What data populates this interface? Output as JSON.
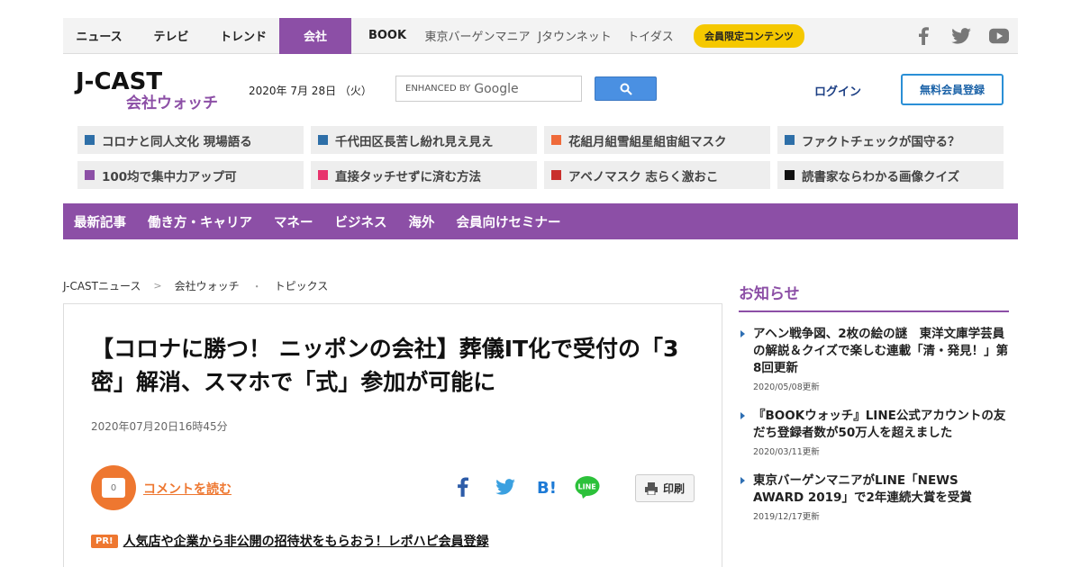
{
  "topnav": {
    "items": [
      "ニュース",
      "テレビ",
      "トレンド",
      "会社",
      "BOOK",
      "東京バーゲンマニア",
      "Jタウンネット",
      "トイダス"
    ],
    "badge": "会員限定コンテンツ",
    "social_icons": [
      "facebook-icon",
      "twitter-icon",
      "youtube-icon"
    ],
    "accent_color": "#8c4fa6"
  },
  "header": {
    "logo_main": "J-CAST",
    "logo_sub": "会社ウォッチ",
    "date": "2020年 7月 28日 （火）",
    "search_label": "ENHANCED BY",
    "search_brand": "Google",
    "login": "ログイン",
    "signup": "無料会員登録"
  },
  "topics": [
    {
      "label": "コロナと同人文化 現場語る",
      "color": "#2e6fa8"
    },
    {
      "label": "千代田区長苦し紛れ見え見え",
      "color": "#2e6fa8"
    },
    {
      "label": "花組月組雪組星組宙組マスク",
      "color": "#ef6a3a"
    },
    {
      "label": "ファクトチェックが国守る？",
      "color": "#2e6fa8"
    },
    {
      "label": "100均で集中力アップ可",
      "color": "#8c4fa6"
    },
    {
      "label": "直接タッチせずに済む方法",
      "color": "#e8336d"
    },
    {
      "label": "アベノマスク 志らく激おこ",
      "color": "#c9302c"
    },
    {
      "label": "読書家ならわかる画像クイズ",
      "color": "#111111"
    }
  ],
  "catnav": [
    "最新記事",
    "働き方・キャリア",
    "マネー",
    "ビジネス",
    "海外",
    "会員向けセミナー"
  ],
  "breadcrumb": [
    "J-CASTニュース",
    "会社ウォッチ",
    "トピックス"
  ],
  "article": {
    "title": "【コロナに勝つ！ ニッポンの会社】葬儀IT化で受付の「3密」解消、スマホで「式」参加が可能に",
    "time": "2020年07月20日16時45分",
    "comment_count": "0",
    "comment_link": "コメントを読む",
    "print": "印刷",
    "pr_tag": "PR!",
    "pr_text": "人気店や企業から非公開の招待状をもらおう！レポハピ会員登録"
  },
  "sidebar": {
    "heading": "お知らせ",
    "news": [
      {
        "title": "アヘン戦争図、2枚の絵の謎　東洋文庫学芸員の解説＆クイズで楽しむ連載「清・発見！」第8回更新",
        "date": "2020/05/08更新"
      },
      {
        "title": "『BOOKウォッチ』LINE公式アカウントの友だち登録者数が50万人を超えました",
        "date": "2020/03/11更新"
      },
      {
        "title": "東京バーゲンマニアがLINE「NEWS AWARD 2019」で2年連続大賞を受賞",
        "date": "2019/12/17更新"
      }
    ]
  }
}
